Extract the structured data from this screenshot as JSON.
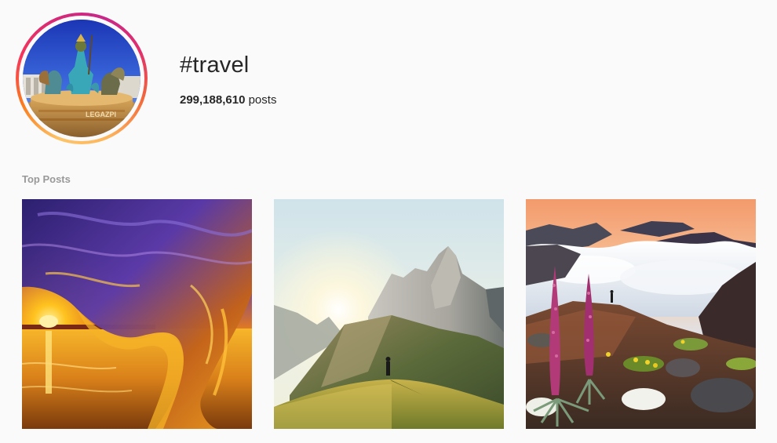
{
  "hashtag": {
    "title": "#travel",
    "post_count": "299,188,610",
    "post_count_suffix": "posts"
  },
  "sections": {
    "top_posts_label": "Top Posts"
  },
  "icons": {
    "avatar": "hashtag-profile-image",
    "post_1": "wave-sunset-photo",
    "post_2": "mountain-hiker-photo",
    "post_3": "cloud-sea-flowers-photo"
  },
  "colors": {
    "background": "#fafafa",
    "text": "#262626",
    "muted": "#999999",
    "ring_start": "#fdc468",
    "ring_mid": "#d62976",
    "ring_end": "#fa7e1e"
  }
}
